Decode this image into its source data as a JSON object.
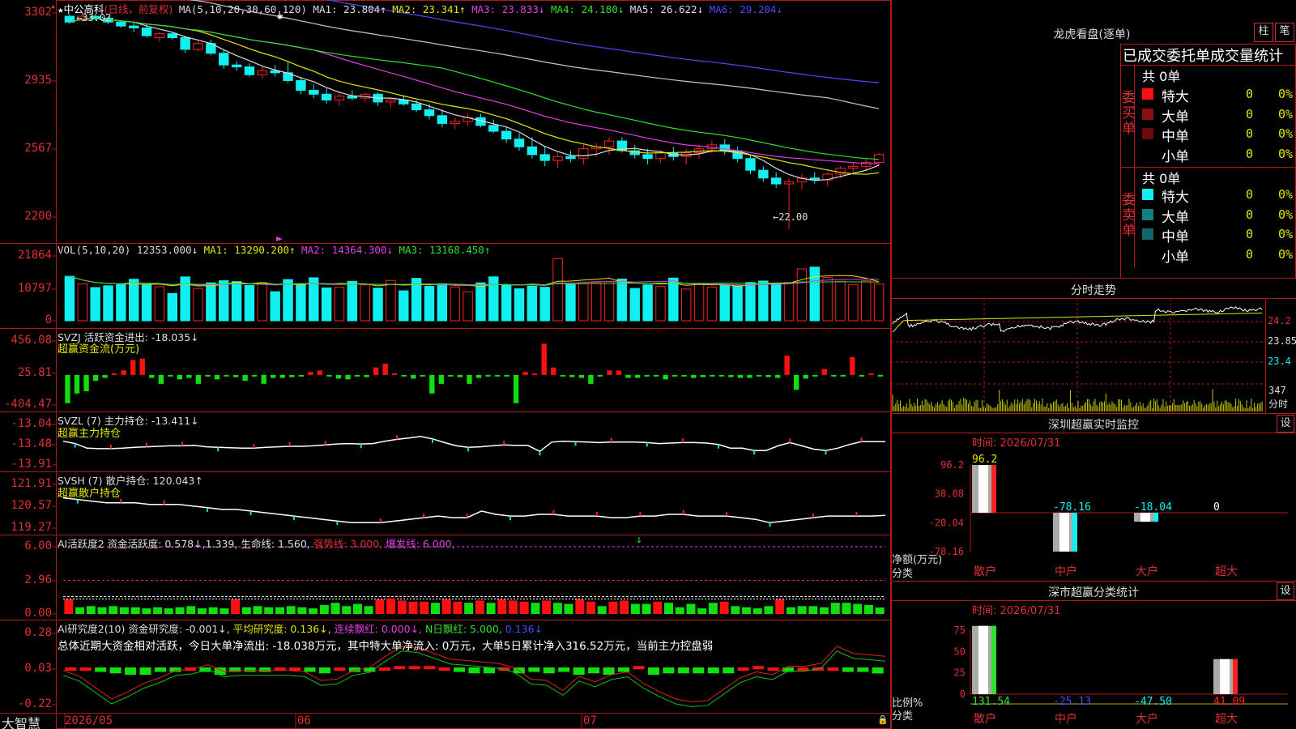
{
  "stock": {
    "star": "★",
    "name": "中公高科",
    "period": "(日线，前复权)"
  },
  "main_indicators": [
    {
      "label": "MA(5,10,20,30,60,120)",
      "color": "#dddddd"
    },
    {
      "label": "MA1: 23.804↑",
      "color": "#dddddd"
    },
    {
      "label": "MA2: 23.341↑",
      "color": "#e6e600"
    },
    {
      "label": "MA3: 23.833↓",
      "color": "#e040e0"
    },
    {
      "label": "MA4: 24.180↓",
      "color": "#30e030"
    },
    {
      "label": "MA5: 26.622↓",
      "color": "#dddddd"
    },
    {
      "label": "MA6: 29.204↓",
      "color": "#4a4aff"
    }
  ],
  "price_axis": [
    "3302",
    "2935",
    "2567",
    "2200"
  ],
  "price_annotations": {
    "high": "←33.02",
    "low": "←22.00"
  },
  "vol": {
    "header": [
      {
        "label": "VOL(5,10,20)",
        "color": "#dddddd"
      },
      {
        "label": "12353.000↓",
        "color": "#dddddd"
      },
      {
        "label": "MA1: 13290.200↑",
        "color": "#e6e600"
      },
      {
        "label": "MA2: 14364.300↓",
        "color": "#e040e0"
      },
      {
        "label": "MA3: 13168.450↑",
        "color": "#30e030"
      }
    ],
    "axis": [
      "21864",
      "10797",
      "0"
    ]
  },
  "svzj": {
    "header": [
      {
        "label": "SVZJ  活跃资金进出: -18.035↓",
        "color": "#dddddd"
      }
    ],
    "subtitle": "超赢资金流(万元)",
    "axis": [
      "456.08",
      "25.81",
      "-404.47"
    ]
  },
  "svzl": {
    "header": [
      {
        "label": "SVZL (7) 主力持仓: -13.411↓",
        "color": "#dddddd"
      }
    ],
    "subtitle": "超赢主力持仓",
    "axis": [
      "-13.04",
      "-13.48",
      "-13.91"
    ]
  },
  "svsh": {
    "header": [
      {
        "label": "SVSH (7) 散户持仓: 120.043↑",
        "color": "#dddddd"
      }
    ],
    "subtitle": "超赢散户持仓",
    "axis": [
      "121.91",
      "120.57",
      "119.27"
    ]
  },
  "ai_active": {
    "header": [
      {
        "label": "AI活跃度2 资金活跃度: 0.578↓,1.339,",
        "color": "#dddddd"
      },
      {
        "label": "生命线: 1.560,",
        "color": "#dddddd"
      },
      {
        "label": "强势线: 3.000,",
        "color": "#e03030"
      },
      {
        "label": "爆发线: 6.000,",
        "color": "#e040e0"
      }
    ],
    "axis": [
      "6.00",
      "2.96",
      "0.00"
    ]
  },
  "ai_research": {
    "header": [
      {
        "label": "AI研究度2(10) 资金研究度: -0.001↓,",
        "color": "#dddddd"
      },
      {
        "label": "平均研究度: 0.136↓,",
        "color": "#e6e600"
      },
      {
        "label": "连续飘红: 0.000↓,",
        "color": "#e040e0"
      },
      {
        "label": "N日飘红: 5.000,",
        "color": "#30e030"
      },
      {
        "label": "0.136↓",
        "color": "#4a4aff"
      }
    ],
    "summary": "总体近期大资金相对活跃，今日大单净流出: -18.038万元，其中特大单净流入: 0万元，大单5日累计净入316.52万元，当前主力控盘弱",
    "axis": [
      "0.28",
      "0.03",
      "-0.22"
    ]
  },
  "date_axis": [
    "2026/05",
    "06",
    "07"
  ],
  "brand": "大智慧",
  "dragon": {
    "title": "龙虎看盘(逐单)",
    "btn1": "柱",
    "btn2": "笔",
    "tabs": "已成交委托单成交量统计",
    "buy": {
      "side_label": "委买单",
      "total": "共 0单",
      "rows": [
        {
          "label": "特大",
          "count": "0",
          "pct": "0%",
          "color": "#ff1010"
        },
        {
          "label": "大单",
          "count": "0",
          "pct": "0%",
          "color": "#8a1010"
        },
        {
          "label": "中单",
          "count": "0",
          "pct": "0%",
          "color": "#6a0a0a"
        },
        {
          "label": "小单",
          "count": "0",
          "pct": "0%",
          "color": "#000000"
        }
      ]
    },
    "sell": {
      "side_label": "委卖单",
      "total": "共 0单",
      "rows": [
        {
          "label": "特大",
          "count": "0",
          "pct": "0%",
          "color": "#10f0f0"
        },
        {
          "label": "大单",
          "count": "0",
          "pct": "0%",
          "color": "#108080"
        },
        {
          "label": "中单",
          "count": "0",
          "pct": "0%",
          "color": "#106868"
        },
        {
          "label": "小单",
          "count": "0",
          "pct": "0%",
          "color": "#000000"
        }
      ]
    }
  },
  "intraday": {
    "title": "分时走势",
    "price_ticks": [
      "24.2",
      "23.85",
      "23.4"
    ],
    "vol_label": "347",
    "unit": "分时"
  },
  "monitor": {
    "title": "深圳超赢实时监控",
    "btn": "设",
    "time_label": "时间: 2026/07/31",
    "axis": [
      "96.2",
      "38.08",
      "-20.04",
      "-78.16"
    ],
    "ylabel": "净额(万元)",
    "xlabel": "分类",
    "categories": [
      "散户",
      "中户",
      "大户",
      "超大"
    ],
    "values": [
      96.2,
      -78.16,
      -18.04,
      0
    ],
    "value_labels": [
      "96.2",
      "-78.16",
      "-18.04",
      "0"
    ]
  },
  "classify": {
    "title": "深市超赢分类统计",
    "btn": "设",
    "time_label": "时间: 2026/07/31",
    "axis": [
      "75",
      "50",
      "25",
      "0"
    ],
    "ylabel": "比例%",
    "xlabel": "分类",
    "categories": [
      "散户",
      "中户",
      "大户",
      "超大"
    ],
    "values": [
      131.54,
      -25.13,
      -47.5,
      41.09
    ],
    "value_labels": [
      "131.54",
      "-25.13",
      "-47.50",
      "41.09"
    ]
  },
  "chart_data": [
    {
      "type": "candlestick",
      "title": "中公高科 (日线，前复权)",
      "x": [
        "2026/05",
        "06",
        "07"
      ],
      "ohlc": [
        [
          32.9,
          33.0,
          32.5,
          32.6
        ],
        [
          32.7,
          33.0,
          32.6,
          32.9
        ],
        [
          32.9,
          33.02,
          32.7,
          32.8
        ],
        [
          32.8,
          32.9,
          32.5,
          32.6
        ],
        [
          32.6,
          32.7,
          32.3,
          32.4
        ],
        [
          32.4,
          32.6,
          32.1,
          32.3
        ],
        [
          32.3,
          32.5,
          31.8,
          31.9
        ],
        [
          31.8,
          32.1,
          31.6,
          32.0
        ],
        [
          32.0,
          32.1,
          31.7,
          31.8
        ],
        [
          31.8,
          31.9,
          31.0,
          31.2
        ],
        [
          31.2,
          31.6,
          31.1,
          31.5
        ],
        [
          31.5,
          31.7,
          30.9,
          31.0
        ],
        [
          31.0,
          31.2,
          30.2,
          30.4
        ],
        [
          30.4,
          30.6,
          30.1,
          30.3
        ],
        [
          30.3,
          30.5,
          29.8,
          29.9
        ],
        [
          29.9,
          30.3,
          29.7,
          30.1
        ],
        [
          30.1,
          30.4,
          29.8,
          30.0
        ],
        [
          30.0,
          30.6,
          29.5,
          29.6
        ],
        [
          29.6,
          29.8,
          28.9,
          29.1
        ],
        [
          29.1,
          29.4,
          28.7,
          28.9
        ],
        [
          28.9,
          29.2,
          28.4,
          28.6
        ],
        [
          28.6,
          29.0,
          28.3,
          28.8
        ],
        [
          28.8,
          29.1,
          28.6,
          28.7
        ],
        [
          28.7,
          29.0,
          28.5,
          28.9
        ],
        [
          28.9,
          29.0,
          28.3,
          28.5
        ],
        [
          28.5,
          28.7,
          28.2,
          28.6
        ],
        [
          28.6,
          28.8,
          28.3,
          28.4
        ],
        [
          28.4,
          28.6,
          28.0,
          28.1
        ],
        [
          28.1,
          28.4,
          27.6,
          27.8
        ],
        [
          27.8,
          28.1,
          27.2,
          27.4
        ],
        [
          27.4,
          27.7,
          27.1,
          27.5
        ],
        [
          27.5,
          27.9,
          27.3,
          27.7
        ],
        [
          27.7,
          27.9,
          27.2,
          27.3
        ],
        [
          27.3,
          27.6,
          26.9,
          27.0
        ],
        [
          27.0,
          27.2,
          26.4,
          26.6
        ],
        [
          26.6,
          26.9,
          26.0,
          26.2
        ],
        [
          26.2,
          26.7,
          25.6,
          25.8
        ],
        [
          25.8,
          26.2,
          25.2,
          25.5
        ],
        [
          25.5,
          25.9,
          25.1,
          25.7
        ],
        [
          25.7,
          26.0,
          25.4,
          25.6
        ],
        [
          25.6,
          26.3,
          25.3,
          26.1
        ],
        [
          26.1,
          26.4,
          25.7,
          26.2
        ],
        [
          26.2,
          26.7,
          25.8,
          26.5
        ],
        [
          26.5,
          26.7,
          25.9,
          26.0
        ],
        [
          26.0,
          26.3,
          25.6,
          25.8
        ],
        [
          25.8,
          26.1,
          25.3,
          25.6
        ],
        [
          25.6,
          26.0,
          25.4,
          25.9
        ],
        [
          25.9,
          26.2,
          25.5,
          25.7
        ],
        [
          25.7,
          26.1,
          25.3,
          25.9
        ],
        [
          25.9,
          26.3,
          25.6,
          26.1
        ],
        [
          26.1,
          26.5,
          25.9,
          26.3
        ],
        [
          26.3,
          26.6,
          25.8,
          26.0
        ],
        [
          26.0,
          26.2,
          25.4,
          25.6
        ],
        [
          25.6,
          25.8,
          24.8,
          25.0
        ],
        [
          25.0,
          25.2,
          24.4,
          24.6
        ],
        [
          24.6,
          24.9,
          24.1,
          24.3
        ],
        [
          24.3,
          24.6,
          22.0,
          24.4
        ],
        [
          24.4,
          24.8,
          24.0,
          24.6
        ],
        [
          24.6,
          24.9,
          24.3,
          24.5
        ],
        [
          24.5,
          24.9,
          24.2,
          24.8
        ],
        [
          24.8,
          25.2,
          24.6,
          25.1
        ],
        [
          25.1,
          25.4,
          24.9,
          25.2
        ],
        [
          25.2,
          25.6,
          25.0,
          25.4
        ],
        [
          25.4,
          25.9,
          25.2,
          25.8
        ]
      ],
      "ylim": [
        22.0,
        33.02
      ],
      "ma_labels": [
        "MA1: 23.804",
        "MA2: 23.341",
        "MA3: 23.833",
        "MA4: 24.180",
        "MA5: 26.622",
        "MA6: 29.204"
      ]
    },
    {
      "type": "bar",
      "title": "VOL(5,10,20)",
      "values": [
        15000,
        12500,
        11200,
        11800,
        12200,
        14000,
        12300,
        11500,
        9200,
        14800,
        10900,
        12800,
        13500,
        13200,
        11900,
        12900,
        9800,
        13900,
        12200,
        14500,
        11100,
        11300,
        13300,
        12100,
        11000,
        13600,
        10100,
        14300,
        11600,
        12500,
        11400,
        9800,
        12800,
        14800,
        11900,
        10800,
        11700,
        11300,
        20900,
        12300,
        12600,
        12900,
        13200,
        14100,
        10900,
        12100,
        11600,
        14400,
        10700,
        12500,
        11300,
        12100,
        11800,
        12900,
        13400,
        12600,
        12900,
        17500,
        18100,
        14600,
        13300,
        12200,
        13500,
        12353
      ],
      "ylim": [
        0,
        21864
      ],
      "series_labels": [
        "MA1: 13290.200",
        "MA2: 14364.300",
        "MA3: 13168.450"
      ]
    },
    {
      "type": "bar",
      "title": "SVZJ 活跃资金进出",
      "values": [
        -380,
        -250,
        -220,
        -80,
        -40,
        20,
        60,
        200,
        220,
        -40,
        -120,
        -20,
        -60,
        -40,
        -120,
        -20,
        -60,
        -20,
        -30,
        -80,
        -20,
        -120,
        -40,
        -40,
        -30,
        -20,
        40,
        60,
        -20,
        -50,
        -60,
        -20,
        -30,
        100,
        150,
        20,
        -20,
        -50,
        -20,
        -250,
        -120,
        -20,
        -30,
        -120,
        -40,
        -20,
        -20,
        -20,
        -380,
        40,
        20,
        420,
        100,
        -20,
        -30,
        -40,
        -120,
        -20,
        60,
        60,
        -40,
        -40,
        -20,
        -20,
        -60,
        -20,
        -20,
        -40,
        -30,
        -20,
        -20,
        -30,
        -40,
        -40,
        -20,
        -30,
        -40,
        260,
        -200,
        -50,
        -20,
        80,
        -20,
        -20,
        240,
        -20,
        20,
        -18.035
      ],
      "ylim": [
        -404.47,
        456.08
      ]
    },
    {
      "type": "line",
      "title": "SVZL 主力持仓",
      "values": [
        -13.4,
        -13.45,
        -13.55,
        -13.56,
        -13.56,
        -13.55,
        -13.53,
        -13.52,
        -13.51,
        -13.5,
        -13.5,
        -13.49,
        -13.52,
        -13.53,
        -13.54,
        -13.55,
        -13.55,
        -13.53,
        -13.52,
        -13.51,
        -13.51,
        -13.5,
        -13.48,
        -13.46,
        -13.45,
        -13.46,
        -13.45,
        -13.4,
        -13.36,
        -13.33,
        -13.3,
        -13.35,
        -13.43,
        -13.5,
        -13.53,
        -13.52,
        -13.5,
        -13.48,
        -13.49,
        -13.49,
        -13.62,
        -13.42,
        -13.4,
        -13.41,
        -13.42,
        -13.43,
        -13.42,
        -13.42,
        -13.42,
        -13.43,
        -13.45,
        -13.44,
        -13.43,
        -13.43,
        -13.44,
        -13.47,
        -13.55,
        -13.55,
        -13.6,
        -13.6,
        -13.5,
        -13.43,
        -13.5,
        -13.57,
        -13.6,
        -13.55,
        -13.47,
        -13.41,
        -13.41,
        -13.411
      ],
      "ylim": [
        -13.91,
        -13.04
      ]
    },
    {
      "type": "line",
      "title": "SVSH 散户持仓",
      "values": [
        121.1,
        121.0,
        120.9,
        120.8,
        120.8,
        120.8,
        120.7,
        120.7,
        120.7,
        120.6,
        120.5,
        120.4,
        120.4,
        120.3,
        120.2,
        120.1,
        120.0,
        119.9,
        119.8,
        119.7,
        119.6,
        119.6,
        119.6,
        119.7,
        119.8,
        119.9,
        120.0,
        119.9,
        119.9,
        120.3,
        120.1,
        120.0,
        120.0,
        120.1,
        120.1,
        120.0,
        120.0,
        120.0,
        119.9,
        119.9,
        120.0,
        120.0,
        120.1,
        120.1,
        120.0,
        120.0,
        120.0,
        119.9,
        119.8,
        119.6,
        119.7,
        119.8,
        119.9,
        120.0,
        120.0,
        120.0,
        120.0,
        120.043
      ],
      "ylim": [
        119.27,
        121.91
      ]
    },
    {
      "type": "bar",
      "title": "AI活跃度2",
      "values": [
        1.3,
        0.6,
        0.7,
        0.6,
        0.7,
        0.6,
        0.6,
        0.5,
        0.6,
        0.5,
        0.6,
        0.7,
        0.5,
        0.6,
        0.5,
        1.3,
        0.6,
        0.7,
        0.6,
        0.6,
        0.7,
        0.6,
        0.5,
        0.8,
        1.0,
        0.7,
        0.9,
        0.7,
        1.3,
        1.4,
        1.2,
        1.1,
        1.1,
        1.0,
        1.3,
        1.1,
        1.0,
        1.2,
        1.0,
        1.3,
        1.2,
        1.1,
        1.0,
        1.2,
        1.0,
        0.9,
        1.3,
        1.1,
        0.7,
        1.1,
        1.2,
        0.9,
        0.9,
        1.1,
        1.0,
        0.6,
        0.9,
        0.5,
        1.0,
        1.1,
        0.7,
        0.6,
        0.5,
        0.7,
        1.3,
        0.6,
        0.7,
        0.7,
        0.6,
        1.0,
        1.0,
        0.9,
        0.8,
        0.578
      ],
      "lines": {
        "生命线": 1.56,
        "强势线": 3.0,
        "爆发线": 6.0
      },
      "ylim": [
        0,
        6
      ]
    },
    {
      "type": "bar",
      "title": "AI研究度2(10)",
      "values": [
        0.03,
        0.03,
        0.01,
        0.0,
        -0.01,
        -0.01,
        0.01,
        0.01,
        0.03,
        0.01,
        -0.01,
        0.01,
        0.01,
        0.01,
        0.03,
        0.02,
        0.01,
        0.0,
        0.02,
        0.01,
        0.01,
        0.03,
        0.04,
        0.04,
        0.04,
        0.03,
        0.01,
        0.0,
        0.0,
        0.02,
        0.0,
        0.01,
        0.0,
        0.01,
        -0.01,
        0.0,
        -0.01,
        0.01,
        0.04,
        -0.01,
        0.0,
        0.0,
        0.0,
        0.0,
        0.0,
        0.02,
        0.04,
        0.02,
        0.01,
        0.02,
        0.02,
        0.02,
        0.01,
        0.01,
        -0.001
      ],
      "line": [
        0.02,
        -0.02,
        -0.1,
        -0.18,
        -0.13,
        -0.07,
        -0.03,
        0.02,
        0.03,
        0.06,
        0.01,
        0.02,
        0.02,
        0.02,
        0.02,
        0.01,
        -0.05,
        -0.04,
        0.02,
        0.04,
        0.12,
        0.19,
        0.18,
        0.14,
        0.1,
        0.09,
        0.08,
        0.07,
        0.04,
        -0.04,
        -0.05,
        -0.12,
        -0.02,
        -0.06,
        -0.01,
        0.01,
        -0.07,
        -0.13,
        -0.18,
        -0.2,
        -0.19,
        -0.11,
        -0.03,
        0.01,
        -0.01,
        0.05,
        0.05,
        0.07,
        0.19,
        0.14,
        0.13,
        0.12
      ],
      "ylim": [
        -0.22,
        0.28
      ]
    },
    {
      "type": "bar",
      "title": "深圳超赢实时监控",
      "categories": [
        "散户",
        "中户",
        "大户",
        "超大"
      ],
      "values": [
        96.2,
        -78.16,
        -18.04,
        0
      ],
      "ylim": [
        -78.16,
        96.2
      ]
    },
    {
      "type": "bar",
      "title": "深市超赢分类统计",
      "categories": [
        "散户",
        "中户",
        "大户",
        "超大"
      ],
      "values": [
        131.54,
        -25.13,
        -47.5,
        41.09
      ],
      "ylim": [
        0,
        75
      ]
    }
  ]
}
